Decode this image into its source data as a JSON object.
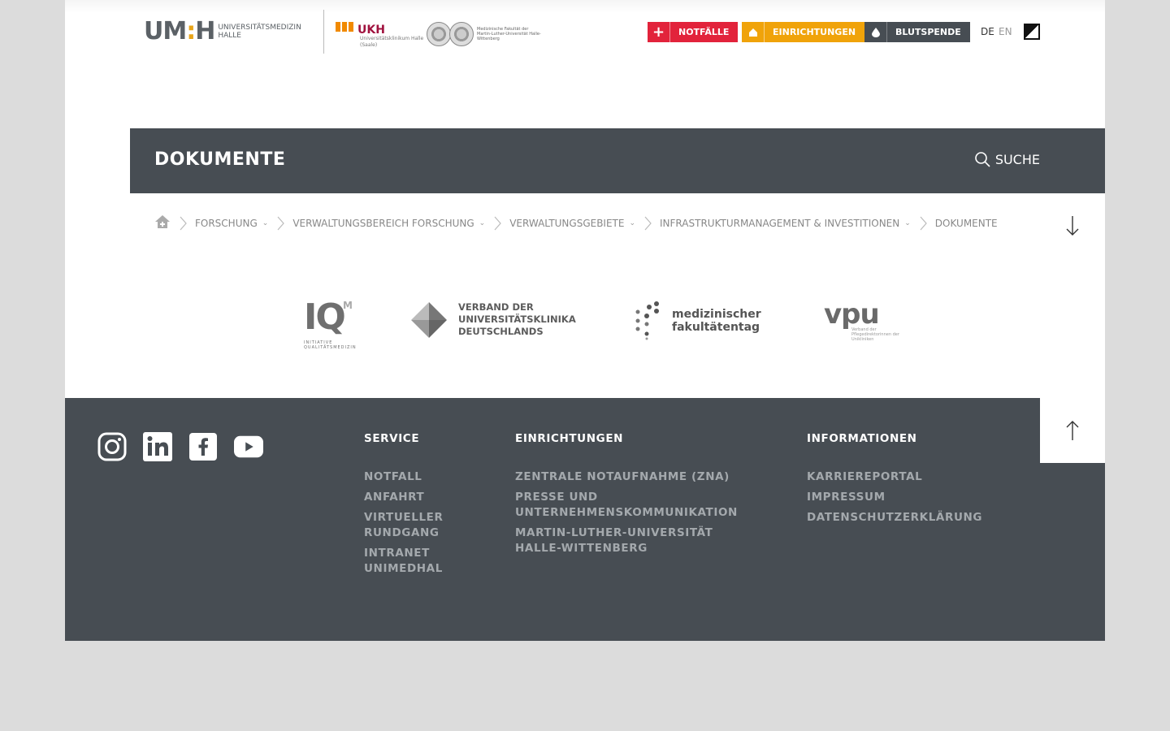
{
  "header": {
    "logo_um_mark": "UM:H",
    "logo_um_text_1": "UNIVERSITÄTSMEDIZIN",
    "logo_um_text_2": "HALLE",
    "logo_ukh_word": "UKH",
    "logo_ukh_sub": "Universitätsklinikum Halle (Saale)",
    "logo_mlu_text": "Medizinische Fakultät der Martin-Luther-Universität Halle-Wittenberg",
    "quick_links": {
      "notfalle": "NOTFÄLLE",
      "einrichtungen": "EINRICHTUNGEN",
      "blutspende": "BLUTSPENDE"
    },
    "lang_de": "DE",
    "lang_en": "EN"
  },
  "titlebar": {
    "title": "DOKUMENTE",
    "search_label": "SUCHE"
  },
  "breadcrumb": {
    "items": [
      "FORSCHUNG",
      "VERWALTUNGSBEREICH FORSCHUNG",
      "VERWALTUNGSGEBIETE",
      "INFRASTRUKTURMANAGEMENT & INVESTITIONEN",
      "DOKUMENTE"
    ]
  },
  "partners": {
    "iqm": {
      "big": "IQ",
      "sup": "M",
      "small": "INITIATIVE QUALITÄTSMEDIZIN"
    },
    "vud": {
      "line1": "VERBAND DER",
      "line2": "UNIVERSITÄTSKLINIKA",
      "line3": "DEUTSCHLANDS"
    },
    "mft": {
      "line1": "medizinischer",
      "line2": "fakultätentag"
    },
    "vpu": {
      "big": "vpu",
      "small": "Verband der Pflegedirektorinnen der Unikliniken"
    }
  },
  "footer": {
    "service": {
      "heading": "SERVICE",
      "links": [
        "NOTFALL",
        "ANFAHRT",
        "VIRTUELLER RUNDGANG",
        "INTRANET UNIMEDHAL"
      ]
    },
    "einrichtungen": {
      "heading": "EINRICHTUNGEN",
      "links": [
        "ZENTRALE NOTAUFNAHME (ZNA)",
        "PRESSE UND UNTERNEHMENSKOMMUNIKATION",
        "MARTIN-LUTHER-UNIVERSITÄT HALLE-WITTENBERG"
      ]
    },
    "informationen": {
      "heading": "INFORMATIONEN",
      "links": [
        "KARRIEREPORTAL",
        "IMPRESSUM",
        "DATENSCHUTZERKLÄRUNG"
      ]
    },
    "social_icons": [
      "instagram-icon",
      "linkedin-icon",
      "facebook-icon",
      "youtube-icon"
    ]
  },
  "colors": {
    "notfall_red": "#e2233b",
    "einrichtungen_orange": "#f0a30a",
    "dark_gray": "#474d53",
    "footer_link": "#a4a9ad"
  }
}
